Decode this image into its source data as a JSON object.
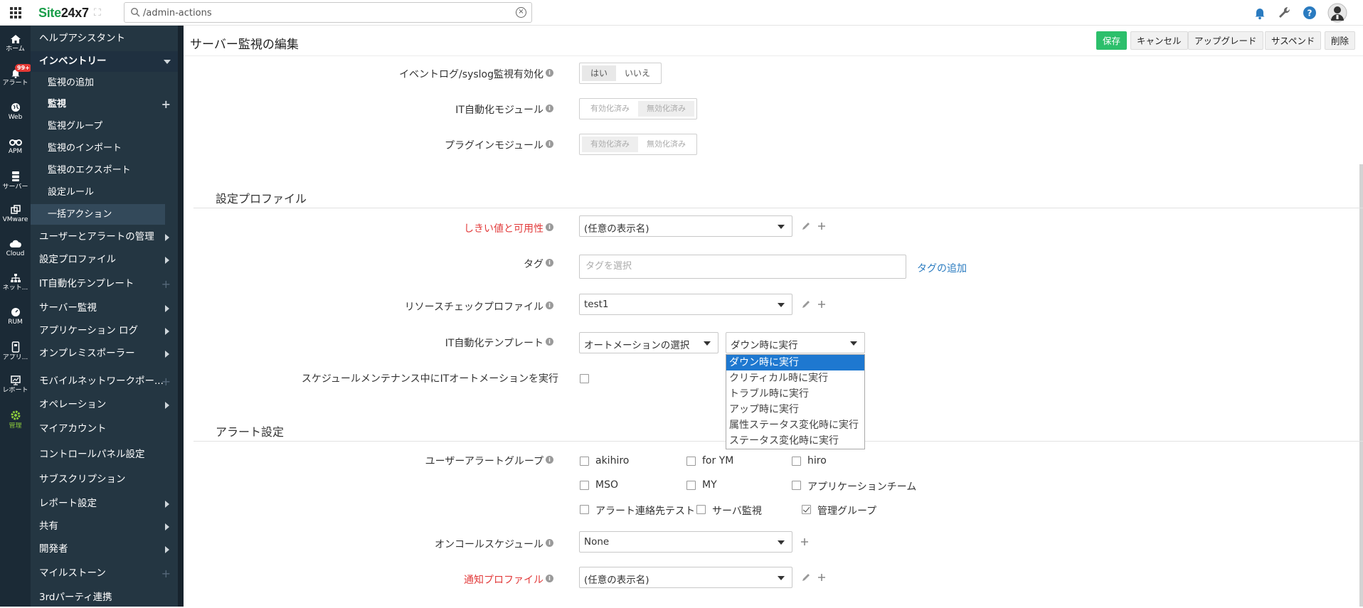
{
  "topbar": {
    "brand_site": "Site",
    "brand_rest": "24x7",
    "search_value": "/admin-actions"
  },
  "rail": [
    {
      "label": "ホーム",
      "icon": "home-icon"
    },
    {
      "label": "アラート",
      "icon": "bell-icon",
      "badge": "99+"
    },
    {
      "label": "Web",
      "icon": "globe-icon"
    },
    {
      "label": "APM",
      "icon": "binoculars-icon"
    },
    {
      "label": "サーバー",
      "icon": "server-icon"
    },
    {
      "label": "VMware",
      "icon": "vm-icon"
    },
    {
      "label": "Cloud",
      "icon": "cloud-icon"
    },
    {
      "label": "ネット...",
      "icon": "network-icon"
    },
    {
      "label": "RUM",
      "icon": "rum-icon"
    },
    {
      "label": "アプリ...",
      "icon": "app-icon"
    },
    {
      "label": "レポート",
      "icon": "report-icon"
    },
    {
      "label": "管理",
      "icon": "gear-icon"
    }
  ],
  "sidebar": {
    "items": [
      {
        "label": "ヘルプアシスタント"
      },
      {
        "label": "インベントリー"
      },
      {
        "label": "監視の追加"
      },
      {
        "label": "監視"
      },
      {
        "label": "監視グループ"
      },
      {
        "label": "監視のインポート"
      },
      {
        "label": "監視のエクスポート"
      },
      {
        "label": "設定ルール"
      },
      {
        "label": "一括アクション"
      },
      {
        "label": "ユーザーとアラートの管理"
      },
      {
        "label": "設定プロファイル"
      },
      {
        "label": "IT自動化テンプレート"
      },
      {
        "label": "サーバー監視"
      },
      {
        "label": "アプリケーション ログ"
      },
      {
        "label": "オンプレミスポーラー"
      },
      {
        "label": "モバイルネットワークポー..."
      },
      {
        "label": "オペレーション"
      },
      {
        "label": "マイアカウント"
      },
      {
        "label": "コントロールパネル設定"
      },
      {
        "label": "サブスクリプション"
      },
      {
        "label": "レポート設定"
      },
      {
        "label": "共有"
      },
      {
        "label": "開発者"
      },
      {
        "label": "マイルストーン"
      },
      {
        "label": "3rdパーティ連携"
      }
    ]
  },
  "header": {
    "title": "サーバー監視の編集",
    "buttons": {
      "save": "保存",
      "cancel": "キャンセル",
      "upgrade": "アップグレード",
      "suspend": "サスペンド",
      "delete": "削除"
    }
  },
  "form": {
    "eventlog": {
      "label": "イベントログ/syslog監視有効化",
      "opt_yes": "はい",
      "opt_no": "いいえ"
    },
    "it_module": {
      "label": "IT自動化モジュール",
      "opt_enabled": "有効化済み",
      "opt_disabled": "無効化済み"
    },
    "plugin_module": {
      "label": "プラグインモジュール",
      "opt_enabled": "有効化済み",
      "opt_disabled": "無効化済み"
    },
    "config_section": "設定プロファイル",
    "threshold": {
      "label": "しきい値と可用性",
      "value": "(任意の表示名)"
    },
    "tags": {
      "label": "タグ",
      "placeholder": "タグを選択",
      "add_link": "タグの追加"
    },
    "resource_check": {
      "label": "リソースチェックプロファイル",
      "value": "test1"
    },
    "it_template": {
      "label": "IT自動化テンプレート",
      "value": "オートメーションの選択",
      "run_value": "ダウン時に実行"
    },
    "run_options": [
      "ダウン時に実行",
      "クリティカル時に実行",
      "トラブル時に実行",
      "アップ時に実行",
      "属性ステータス変化時に実行",
      "ステータス変化時に実行"
    ],
    "maintenance": {
      "label": "スケジュールメンテナンス中にITオートメーションを実行"
    },
    "alert_section": "アラート設定",
    "user_alert_group": {
      "label": "ユーザーアラートグループ",
      "groups": [
        {
          "name": "akihiro",
          "checked": false
        },
        {
          "name": "for YM",
          "checked": false
        },
        {
          "name": "hiro",
          "checked": false
        },
        {
          "name": "MSO",
          "checked": false
        },
        {
          "name": "MY",
          "checked": false
        },
        {
          "name": "アプリケーションチーム",
          "checked": false
        },
        {
          "name": "アラート連絡先テスト",
          "checked": false
        },
        {
          "name": "サーバ監視",
          "checked": false
        },
        {
          "name": "管理グループ",
          "checked": true
        }
      ]
    },
    "oncall": {
      "label": "オンコールスケジュール",
      "value": "None"
    },
    "notification": {
      "label": "通知プロファイル",
      "value": "(任意の表示名)"
    }
  }
}
